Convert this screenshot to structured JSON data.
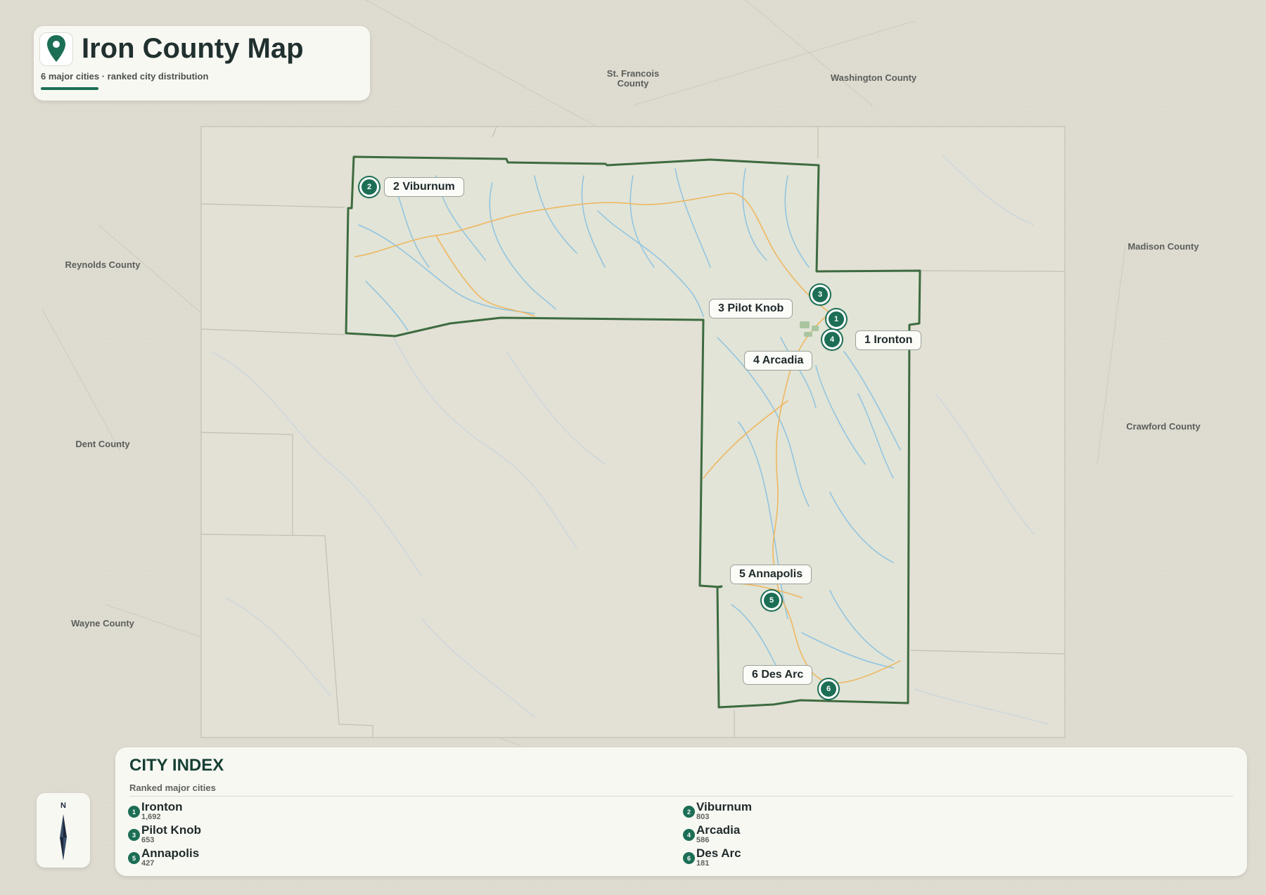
{
  "map": {
    "title": "Iron County Map",
    "subtitle": "6 major cities · ranked city distribution",
    "colors": {
      "county_fill": "#e1e4d6",
      "county_border": "#3d6b3f",
      "rivers": "#8fc3e2",
      "roads": "#f0b45a",
      "marker": "#1c6e55",
      "background": "#dedbd1"
    },
    "neighbors": [
      {
        "name": "St. Francois County",
        "line1": "St. Francois",
        "line2": "County"
      },
      {
        "name": "Washington County"
      },
      {
        "name": "Madison County"
      },
      {
        "name": "Reynolds County"
      },
      {
        "name": "Crawford County"
      },
      {
        "name": "Dent County"
      },
      {
        "name": "Wayne County"
      }
    ],
    "cities": [
      {
        "rank": "1",
        "name": "Ironton",
        "label": "1 Ironton",
        "population": "1,692"
      },
      {
        "rank": "2",
        "name": "Viburnum",
        "label": "2 Viburnum",
        "population": "803"
      },
      {
        "rank": "3",
        "name": "Pilot Knob",
        "label": "3 Pilot Knob",
        "population": "653"
      },
      {
        "rank": "4",
        "name": "Arcadia",
        "label": "4 Arcadia",
        "population": "586"
      },
      {
        "rank": "5",
        "name": "Annapolis",
        "label": "5 Annapolis",
        "population": "427"
      },
      {
        "rank": "6",
        "name": "Des Arc",
        "label": "6 Des Arc",
        "population": "181"
      }
    ]
  },
  "index": {
    "title": "CITY INDEX",
    "subtitle": "Ranked major cities"
  },
  "compass": {
    "north_label": "N",
    "icon": "compass-icon"
  },
  "icons": {
    "title_icon": "map-pin-icon"
  }
}
